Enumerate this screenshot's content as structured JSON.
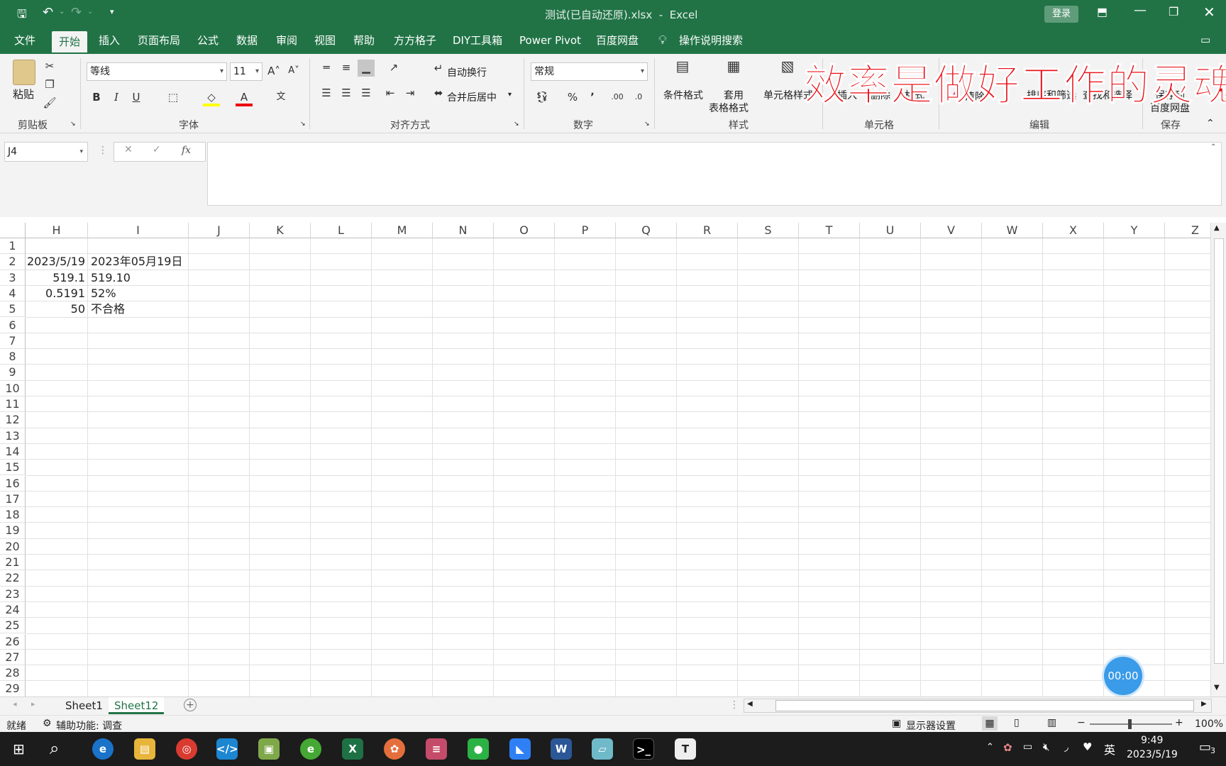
{
  "title_bar": {
    "doc_title": "测试(已自动还原).xlsx  -  Excel",
    "login_label": "登录"
  },
  "ribbon_tabs": [
    "文件",
    "开始",
    "插入",
    "页面布局",
    "公式",
    "数据",
    "审阅",
    "视图",
    "帮助",
    "方方格子",
    "DIY工具箱",
    "Power Pivot",
    "百度网盘"
  ],
  "search_tell": "操作说明搜索",
  "ribbon": {
    "clipboard": {
      "paste": "粘贴",
      "group": "剪贴板"
    },
    "font": {
      "name": "等线",
      "size": "11",
      "group": "字体",
      "bold": "B",
      "italic": "I",
      "underline": "U"
    },
    "align": {
      "wrap": "自动换行",
      "merge": "合并后居中",
      "group": "对齐方式"
    },
    "number": {
      "format": "常规",
      "percent": "%",
      "comma": "ʼ",
      "group": "数字"
    },
    "styles": {
      "cond": "条件格式",
      "table1": "套用",
      "table2": "表格格式",
      "cellstyle": "单元格样式",
      "group": "样式"
    },
    "cells": {
      "insert": "插入",
      "delete": "删除",
      "format": "格式",
      "group": "单元格"
    },
    "editing": {
      "clear": "清除",
      "sort": "排序和筛选",
      "find": "查找和选择",
      "group": "编辑"
    },
    "save": {
      "line1": "保存到",
      "line2": "百度网盘",
      "group": "保存"
    }
  },
  "watermark": "效率是做好工作的灵魂",
  "formula_bar": {
    "name_box": "J4",
    "fx": "fx",
    "content": ""
  },
  "columns": [
    "H",
    "I",
    "J",
    "K",
    "L",
    "M",
    "N",
    "O",
    "P",
    "Q",
    "R",
    "S",
    "T",
    "U",
    "V",
    "W",
    "X",
    "Y",
    "Z"
  ],
  "rows": [
    "1",
    "2",
    "3",
    "4",
    "5",
    "6",
    "7",
    "8",
    "9",
    "10",
    "11",
    "12",
    "13",
    "14",
    "15",
    "16",
    "17",
    "18",
    "19",
    "20",
    "21",
    "22",
    "23",
    "24",
    "25",
    "26",
    "27",
    "28",
    "29"
  ],
  "cells": {
    "H2": "2023/5/19",
    "I2": "2023年05月19日",
    "H3": "519.1",
    "I3": "519.10",
    "H4": "0.5191",
    "I4": "52%",
    "H5": "50",
    "I5": "不合格"
  },
  "sheets": [
    "Sheet1",
    "Sheet12"
  ],
  "active_sheet": "Sheet12",
  "status": {
    "ready": "就绪",
    "accessibility": "辅助功能: 调查",
    "display": "显示器设置",
    "zoom": "100%"
  },
  "timer": "00:00",
  "taskbar": {
    "time": "9:49",
    "date": "2023/5/19",
    "ime": "英",
    "notif_count": "3"
  },
  "colors": {
    "excel_green": "#217346",
    "watermark_red": "#e8141b",
    "timer_blue": "#3a9be8"
  }
}
